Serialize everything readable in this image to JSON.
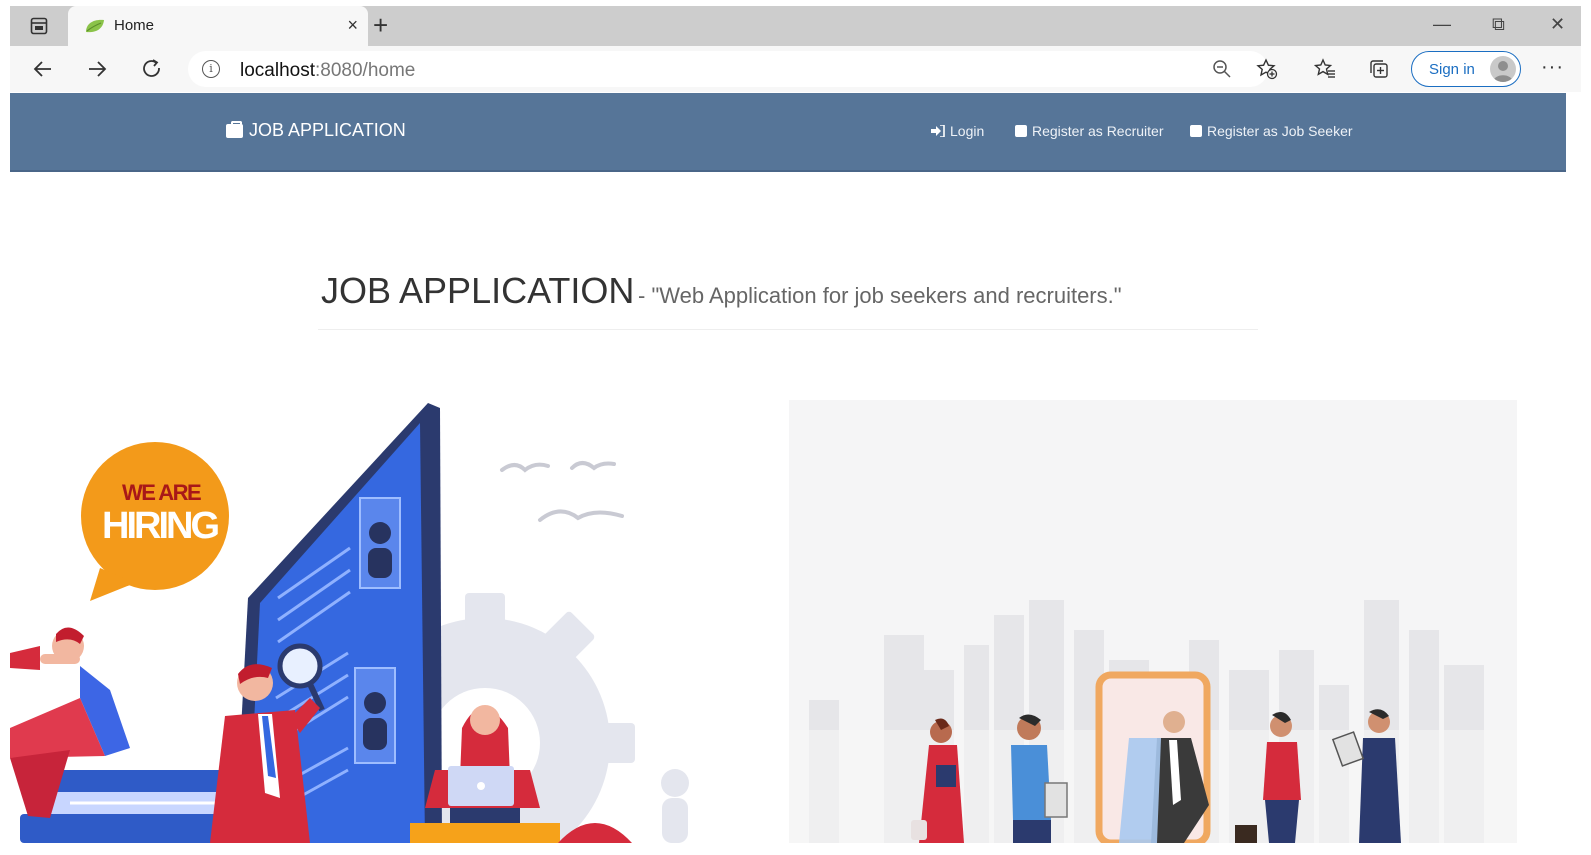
{
  "browser": {
    "tab_title": "Home",
    "tab_close": "×",
    "new_tab": "+",
    "url_host": "localhost",
    "url_path": ":8080/home",
    "sign_in_label": "Sign in",
    "more": "···",
    "window_controls": {
      "minimize": "—",
      "restore": "⧉",
      "close": "✕"
    }
  },
  "navbar": {
    "brand": "JOB APPLICATION",
    "links": [
      {
        "label": "Login",
        "icon": "sign-in-icon"
      },
      {
        "label": "Register as Recruiter",
        "icon": "id-card-icon"
      },
      {
        "label": "Register as Job Seeker",
        "icon": "id-card-icon"
      }
    ]
  },
  "header": {
    "title": "JOB APPLICATION",
    "subtitle": "- \"Web Application for job seekers and recruiters.\""
  },
  "illustration": {
    "badge_line1": "WE ARE",
    "badge_line2": "HIRING"
  },
  "colors": {
    "navbar": "#567598",
    "badge": "#f39a1a",
    "accent_red": "#d52b3c",
    "screen_blue": "#3568e0"
  }
}
